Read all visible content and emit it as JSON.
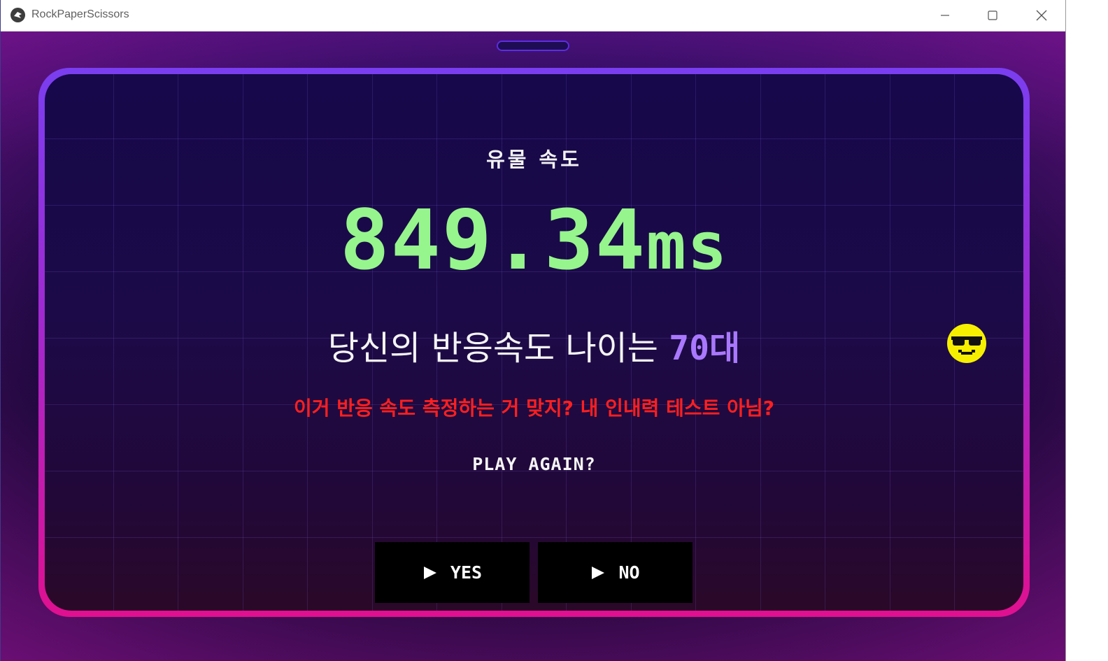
{
  "window": {
    "title": "RockPaperScissors"
  },
  "result": {
    "heading": "유물 속도",
    "score_value": "849.34",
    "score_unit": "ms",
    "age_prefix": "당신의 반응속도 나이는 ",
    "age_value": "70대",
    "comment": "이거 반응 속도 측정하는 거 맞지? 내 인내력 테스트 아님?",
    "play_again": "PLAY AGAIN?"
  },
  "buttons": {
    "yes_label": "YES",
    "no_label": "NO"
  },
  "icons": {
    "app": "app-logo-icon",
    "minimize": "minimize-icon",
    "maximize": "maximize-icon",
    "close": "close-icon",
    "play_arrow": "play-arrow-icon",
    "emoji": "sunglasses-face-icon"
  },
  "colors": {
    "score": "#96f58c",
    "age": "#a978ff",
    "comment": "#ff1f1f",
    "frame_top": "#7a3ef0",
    "frame_bottom": "#e01090",
    "emoji": "#f6f000"
  }
}
